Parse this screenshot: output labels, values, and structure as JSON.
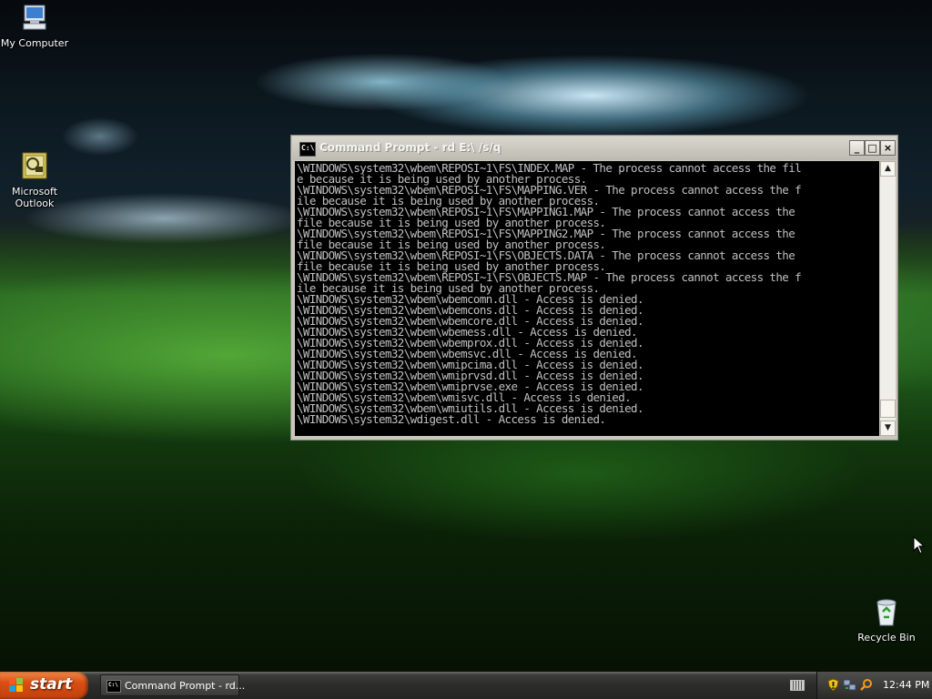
{
  "desktop": {
    "icons": [
      {
        "label": "My Computer",
        "icon": "my-computer-icon"
      },
      {
        "label": "Microsoft\nOutlook",
        "icon": "outlook-icon"
      },
      {
        "label": "Recycle Bin",
        "icon": "recycle-bin-icon"
      }
    ]
  },
  "window": {
    "title": "Command Prompt - rd E:\\ /s/q",
    "icon": "cmd-icon",
    "controls": {
      "minimize": "_",
      "maximize": "□",
      "close": "×"
    },
    "console_lines": [
      "\\WINDOWS\\system32\\wbem\\REPOSI~1\\FS\\INDEX.MAP - The process cannot access the fil",
      "e because it is being used by another process.",
      "\\WINDOWS\\system32\\wbem\\REPOSI~1\\FS\\MAPPING.VER - The process cannot access the f",
      "ile because it is being used by another process.",
      "\\WINDOWS\\system32\\wbem\\REPOSI~1\\FS\\MAPPING1.MAP - The process cannot access the",
      "file because it is being used by another process.",
      "\\WINDOWS\\system32\\wbem\\REPOSI~1\\FS\\MAPPING2.MAP - The process cannot access the",
      "file because it is being used by another process.",
      "\\WINDOWS\\system32\\wbem\\REPOSI~1\\FS\\OBJECTS.DATA - The process cannot access the",
      "file because it is being used by another process.",
      "\\WINDOWS\\system32\\wbem\\REPOSI~1\\FS\\OBJECTS.MAP - The process cannot access the f",
      "ile because it is being used by another process.",
      "\\WINDOWS\\system32\\wbem\\wbemcomn.dll - Access is denied.",
      "\\WINDOWS\\system32\\wbem\\wbemcons.dll - Access is denied.",
      "\\WINDOWS\\system32\\wbem\\wbemcore.dll - Access is denied.",
      "\\WINDOWS\\system32\\wbem\\wbemess.dll - Access is denied.",
      "\\WINDOWS\\system32\\wbem\\wbemprox.dll - Access is denied.",
      "\\WINDOWS\\system32\\wbem\\wbemsvc.dll - Access is denied.",
      "\\WINDOWS\\system32\\wbem\\wmipcima.dll - Access is denied.",
      "\\WINDOWS\\system32\\wbem\\wmiprvsd.dll - Access is denied.",
      "\\WINDOWS\\system32\\wbem\\wmiprvse.exe - Access is denied.",
      "\\WINDOWS\\system32\\wbem\\wmisvc.dll - Access is denied.",
      "\\WINDOWS\\system32\\wbem\\wmiutils.dll - Access is denied.",
      "\\WINDOWS\\system32\\wdigest.dll - Access is denied."
    ]
  },
  "taskbar": {
    "start_label": "start",
    "task_label": "Command Prompt - rd...",
    "clock": "12:44 PM",
    "tray_icons": [
      "security-shield-icon",
      "network-icon",
      "search-icon"
    ]
  },
  "colors": {
    "console_bg": "#000000",
    "console_fg": "#c0c0c0",
    "start_orange": "#d94f14",
    "taskbar": "#2c2c2a"
  }
}
